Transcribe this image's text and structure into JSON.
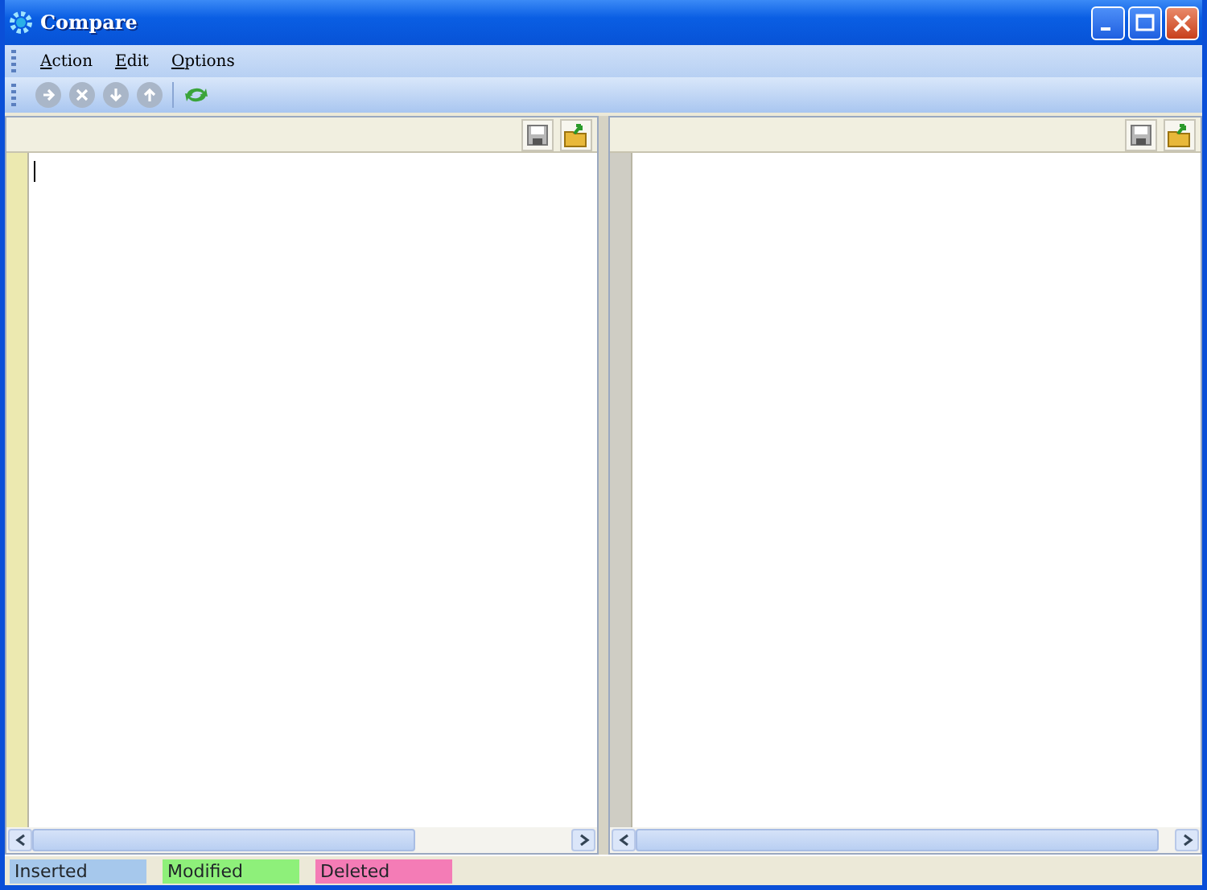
{
  "window": {
    "title": "Compare"
  },
  "menu": [
    {
      "label": "Action"
    },
    {
      "label": "Edit"
    },
    {
      "label": "Options"
    }
  ],
  "toolbar": [
    {
      "kind": "next",
      "disabled": true
    },
    {
      "kind": "stop",
      "disabled": true
    },
    {
      "kind": "down",
      "disabled": true
    },
    {
      "kind": "up",
      "disabled": true
    },
    {
      "kind": "separator"
    },
    {
      "kind": "refresh",
      "disabled": false
    }
  ],
  "panes": [
    {
      "focused": true
    },
    {
      "focused": false
    }
  ],
  "legend": [
    {
      "label": "Inserted",
      "color": "#a6c8ec"
    },
    {
      "label": "Modified",
      "color": "#8ef07a"
    },
    {
      "label": "Deleted",
      "color": "#f47cb6"
    }
  ]
}
